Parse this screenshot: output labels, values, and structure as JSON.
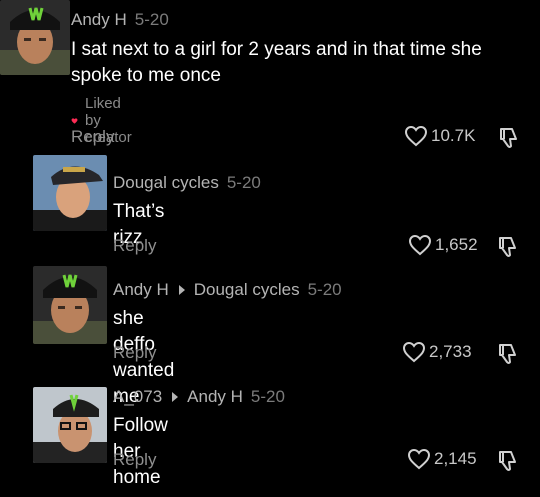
{
  "comments": [
    {
      "author": "Andy H",
      "date": "5-20",
      "text_lines": [
        "I sat next to a girl for 2 years and in that time she",
        "spoke to me once"
      ],
      "liked_by_creator": "Liked by creator",
      "reply_label": "Reply",
      "likes": "10.7K"
    },
    {
      "author": "Dougal cycles",
      "date": "5-20",
      "text": "That’s rizz",
      "reply_label": "Reply",
      "likes": "1,652"
    },
    {
      "author": "Andy H",
      "reply_to": "Dougal cycles",
      "date": "5-20",
      "text": "she deffo wanted me",
      "reply_label": "Reply",
      "likes": "2,733"
    },
    {
      "author": "A_073",
      "reply_to": "Andy H",
      "date": "5-20",
      "text": "Follow her home",
      "reply_label": "Reply",
      "likes": "2,145"
    }
  ],
  "icons": {
    "like": "heart-outline-icon",
    "dislike": "thumbs-down-icon",
    "liked_by_creator": "heart-filled-icon",
    "reply_arrow": "caret-right-icon"
  },
  "colors": {
    "background": "#000000",
    "text": "#ffffff",
    "muted": "#8f8f8f",
    "creator_heart": "#fe2c55"
  }
}
